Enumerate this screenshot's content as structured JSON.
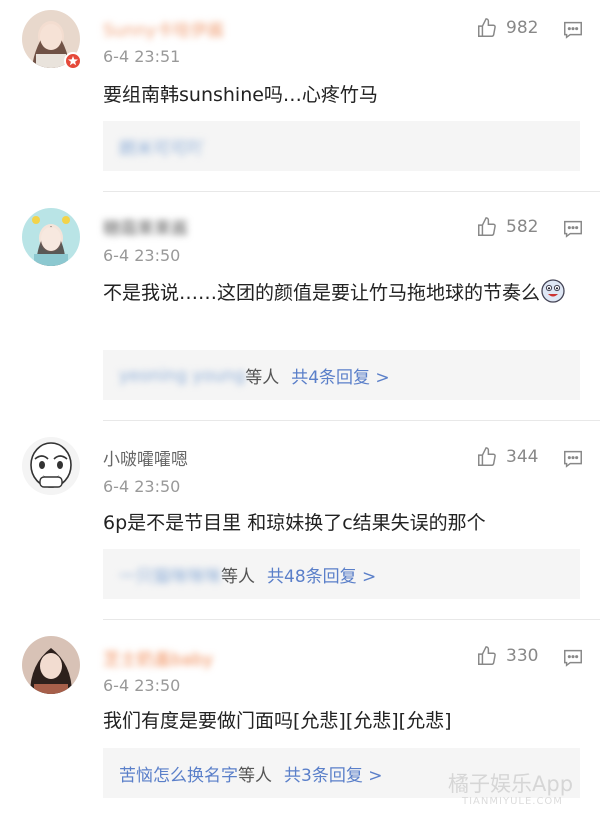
{
  "comments": [
    {
      "name": "Sunny卡哇伊酱",
      "time": "6-4 23:51",
      "likes": "982",
      "content": "要组南韩sunshine吗…心疼竹马",
      "reply_names": "朗米可可吖",
      "reply_deng": "",
      "reply_total": "",
      "avatar_color": "#d9c6b8"
    },
    {
      "name": "糖霜果果酱",
      "time": "6-4 23:50",
      "likes": "582",
      "content": "不是我说……这团的颜值是要让竹马拖地球的节奏么",
      "reply_names": "yeoning young",
      "reply_deng": "等人",
      "reply_total": "共4条回复 >",
      "avatar_color": "#9fd6dc"
    },
    {
      "name": "小啵嚯嚯嗯",
      "time": "6-4 23:50",
      "likes": "344",
      "content": "6p是不是节目里 和琼妹换了c结果失误的那个",
      "reply_names": "一只猫咪咪咪",
      "reply_deng": "等人",
      "reply_total": "共48条回复 >",
      "avatar_color": "#eeeeee"
    },
    {
      "name": "芝士奶盖baby",
      "time": "6-4 23:50",
      "likes": "330",
      "content": "我们有度是要做门面吗[允悲][允悲][允悲]",
      "reply_names": "苦恼怎么换名字",
      "reply_deng": "等人",
      "reply_total": "共3条回复 >",
      "avatar_color": "#c49a86"
    }
  ],
  "watermark": {
    "title": "橘子娱乐App",
    "sub": "TIANMIYULE.COM"
  },
  "colors": {
    "link": "#5a7fc9",
    "badge": "#e5493a"
  },
  "icons": [
    "thumb-up-icon",
    "comment-icon",
    "verified-badge-icon",
    "laugh-cry-emoji"
  ]
}
